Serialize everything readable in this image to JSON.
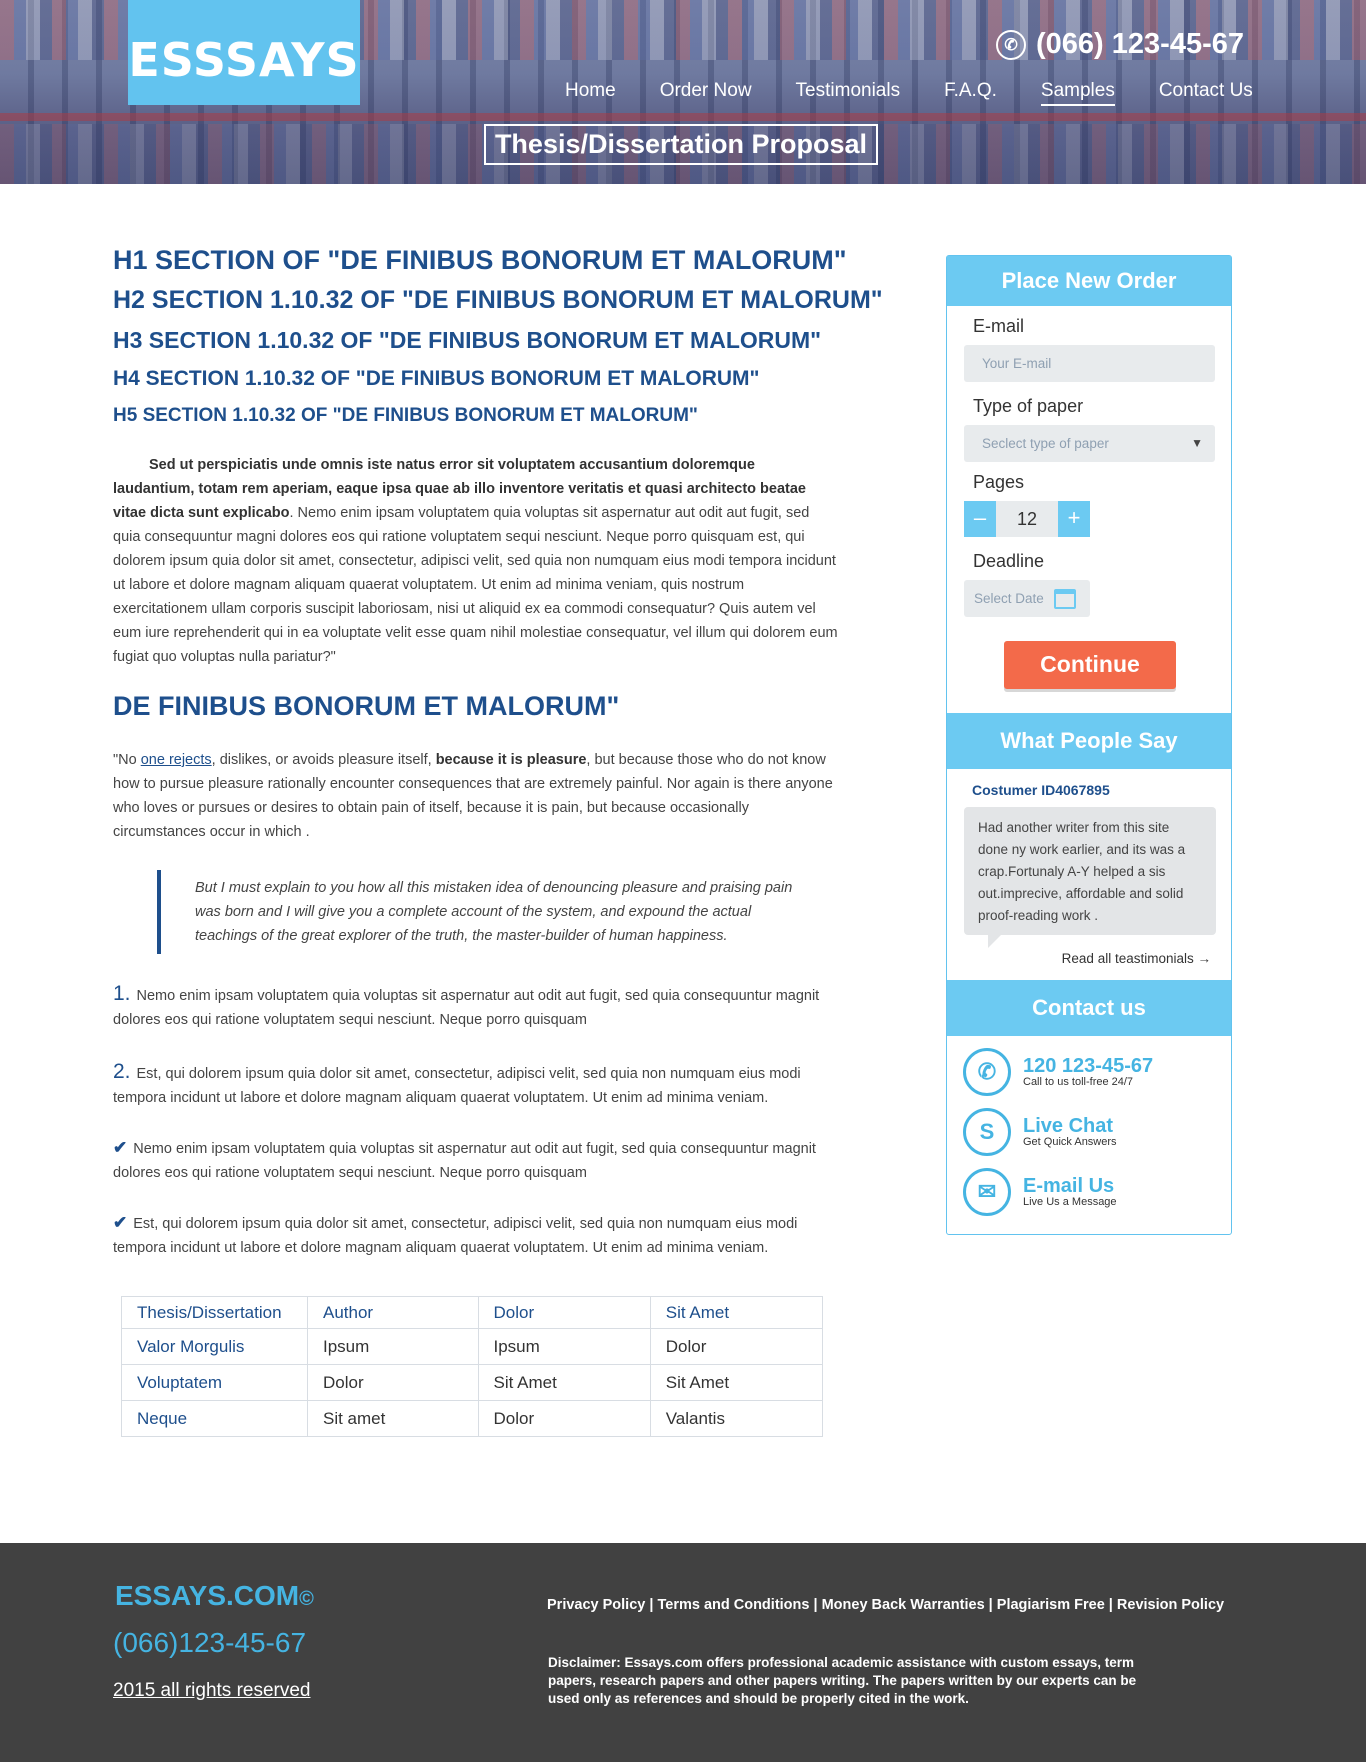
{
  "header": {
    "logo": "ESSSAYS",
    "phone": "(066) 123-45-67",
    "nav": [
      "Home",
      "Order Now",
      "Testimonials",
      "F.A.Q.",
      "Samples",
      "Contact Us"
    ],
    "active_nav": "Samples",
    "page_title": "Thesis/Dissertation Proposal"
  },
  "main": {
    "h1": "H1 SECTION  OF \"DE FINIBUS BONORUM ET MALORUM\"",
    "h2": "H2 SECTION 1.10.32 OF \"DE FINIBUS BONORUM ET MALORUM\"",
    "h3": "H3 SECTION 1.10.32 OF \"DE FINIBUS BONORUM ET MALORUM\"",
    "h4": "H4 SECTION 1.10.32 OF \"DE FINIBUS BONORUM ET MALORUM\"",
    "h5": "H5 SECTION 1.10.32 OF \"DE FINIBUS BONORUM ET MALORUM\"",
    "intro_bold": "Sed ut perspiciatis unde omnis iste natus error sit voluptatem accusantium doloremque laudantium, totam rem aperiam, eaque ipsa quae ab illo inventore veritatis et quasi architecto beatae  vitae dicta sunt explicabo",
    "intro_rest": ". Nemo enim ipsam voluptatem quia voluptas sit aspernatur aut odit aut fugit, sed quia consequuntur magni dolores eos qui ratione voluptatem sequi nesciunt. Neque porro quisquam est, qui dolorem ipsum quia dolor sit amet, consectetur, adipisci velit, sed quia non numquam eius modi tempora incidunt ut labore et dolore magnam aliquam quaerat voluptatem. Ut enim ad minima veniam, quis nostrum exercitationem ullam corporis suscipit laboriosam, nisi ut aliquid ex ea commodi consequatur? Quis autem vel eum iure reprehenderit qui in ea voluptate velit esse quam nihil molestiae consequatur, vel illum qui dolorem eum fugiat quo voluptas nulla pariatur?\"",
    "subheading": "DE FINIBUS BONORUM ET MALORUM\"",
    "p2_start": "\"No ",
    "p2_link": "one rejects",
    "p2_mid": ", dislikes, or avoids pleasure itself, ",
    "p2_bold": "because it is pleasure",
    "p2_end": ", but because those who do not know how to pursue pleasure rationally encounter consequences that are extremely painful. Nor again is there anyone who loves or pursues or desires to obtain pain of itself, because it is pain, but because occasionally circumstances occur in which .",
    "quote": "But I must explain to you how all this mistaken idea of denouncing pleasure and praising pain was born and I will give you a complete account of the system, and expound the actual teachings of the great explorer of the truth, the master-builder of human happiness.",
    "numbered": [
      {
        "n": "1.",
        "text": "Nemo enim ipsam voluptatem quia voluptas sit aspernatur aut odit aut fugit, sed quia consequuntur magnit dolores eos qui ratione voluptatem sequi nesciunt. Neque porro quisquam"
      },
      {
        "n": "2.",
        "text": "Est, qui dolorem ipsum quia dolor sit amet, consectetur, adipisci velit, sed quia non numquam eius modi tempora incidunt ut labore et dolore magnam aliquam quaerat voluptatem. Ut enim ad minima veniam."
      }
    ],
    "checked": [
      "Nemo enim ipsam voluptatem quia voluptas sit aspernatur aut odit aut fugit, sed quia consequuntur magnit dolores eos qui ratione voluptatem sequi nesciunt. Neque porro quisquam",
      "Est, qui dolorem ipsum quia dolor sit amet, consectetur, adipisci velit, sed quia non numquam eius modi tempora incidunt ut labore et dolore magnam aliquam quaerat voluptatem. Ut enim ad minima veniam."
    ],
    "table": [
      [
        "Thesis/Dissertation",
        "Author",
        "Dolor",
        "Sit Amet"
      ],
      [
        "Valor Morgulis",
        "Ipsum",
        "Ipsum",
        "Dolor"
      ],
      [
        "Voluptatem",
        "Dolor",
        "Sit Amet",
        "Sit Amet"
      ],
      [
        "Neque",
        "Sit amet",
        "Dolor",
        "Valantis"
      ]
    ]
  },
  "sidebar": {
    "order_title": "Place New Order",
    "email_label": "E-mail",
    "email_placeholder": "Your E-mail",
    "type_label": "Type of paper",
    "type_placeholder": "Seclect type of paper",
    "pages_label": "Pages",
    "pages_value": "12",
    "minus": "–",
    "plus": "+",
    "deadline_label": "Deadline",
    "date_placeholder": "Select Date",
    "continue": "Continue",
    "reviews_title": "What People Say",
    "customer": "Costumer ID4067895",
    "review": "Had another writer from this site done ny work earlier, and its was a crap.Fortunaly A-Y helped a sis out.imprecive, affordable and solid proof-reading work .",
    "read_all": "Read all teastimonials →",
    "contact_title": "Contact us",
    "contacts": [
      {
        "icon": "phone-icon",
        "title": "120 123-45-67",
        "sub": "Call to us toll-free 24/7"
      },
      {
        "icon": "skype-icon",
        "title": "Live Chat",
        "sub": "Get Quick Answers"
      },
      {
        "icon": "mail-icon",
        "title": "E-mail Us",
        "sub": "Live Us a Message"
      }
    ]
  },
  "footer": {
    "brand": "ESSAYS.COM",
    "copy": "©",
    "phone": "(066)123-45-67",
    "rights": "2015 all rights reserved",
    "links": [
      "Privacy Policy",
      "Terms and Conditions",
      "Money Back Warranties",
      "Plagiarism Free",
      "Revision Policy"
    ],
    "disclaimer": "Disclaimer: Essays.com offers professional academic assistance with custom essays, term papers, research papers and other papers writing. The papers written by our experts can be used only as references and should be properly cited in the work."
  }
}
